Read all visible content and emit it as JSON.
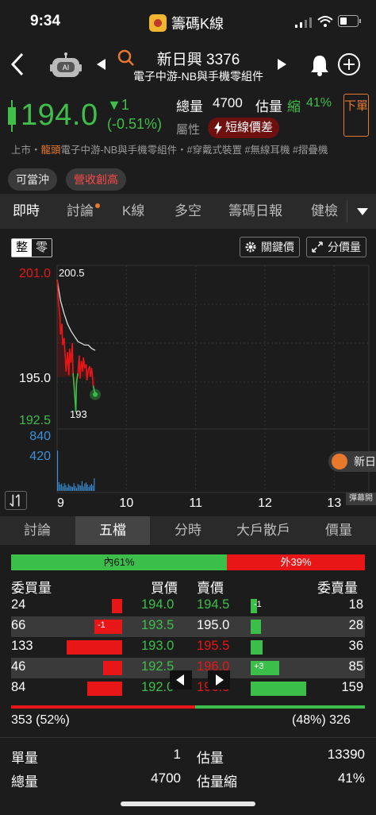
{
  "status_bar": {
    "time": "9:34",
    "app_title": "籌碼K線"
  },
  "header": {
    "stock_name": "新日興 3376",
    "sector": "電子中游-NB與手機零組件",
    "ai_label": "AI"
  },
  "quote": {
    "price": "194.0",
    "change": "▼1",
    "change_pct": "(-0.51%)",
    "total_volume_label": "總量",
    "total_volume": "4700",
    "est_volume_label": "估量",
    "est_status": "縮",
    "est_pct": "41%",
    "attribute_label": "屬性",
    "attribute_badge": "短線價差",
    "order_button": "下單",
    "color_down": "#3fbf4a",
    "color_up": "#e81616"
  },
  "tags": {
    "market": "上市",
    "sep1": "・",
    "leader": "龍頭",
    "sector": "電子中游-NB與手機零組件",
    "sep2": "・",
    "concepts": "#穿戴式裝置 #無線耳機 #摺疊機"
  },
  "pills": [
    "可當沖",
    "營收創高"
  ],
  "tabs": [
    "即時",
    "討論",
    "K線",
    "多空",
    "籌碼日報",
    "健檢"
  ],
  "chart": {
    "toggle_on": "整",
    "toggle_off": "零",
    "key_price_button": "關鍵價",
    "price_dist_button": "分價量",
    "side_chip": "新日",
    "popup_button": "彈幕開"
  },
  "chart_data": {
    "type": "line",
    "title": "",
    "y_labels": {
      "high": "201.0",
      "mid": "195.0",
      "low": "192.5"
    },
    "vol_labels": {
      "top": "840",
      "mid": "420"
    },
    "x_ticks": [
      "9",
      "10",
      "11",
      "12",
      "13"
    ],
    "annotations": {
      "max": "200.5",
      "min": "193"
    },
    "ylim": [
      192.5,
      201.0
    ],
    "xlim": [
      9,
      13.5
    ],
    "price_series": [
      [
        9.0,
        200.5
      ],
      [
        9.02,
        199.2
      ],
      [
        9.04,
        198.5
      ],
      [
        9.05,
        197.4
      ],
      [
        9.07,
        198.0
      ],
      [
        9.08,
        196.8
      ],
      [
        9.1,
        197.2
      ],
      [
        9.12,
        196.0
      ],
      [
        9.13,
        195.3
      ],
      [
        9.15,
        196.4
      ],
      [
        9.17,
        195.1
      ],
      [
        9.18,
        196.6
      ],
      [
        9.2,
        195.8
      ],
      [
        9.22,
        196.9
      ],
      [
        9.23,
        195.2
      ],
      [
        9.25,
        194.2
      ],
      [
        9.27,
        193.0
      ],
      [
        9.28,
        194.7
      ],
      [
        9.3,
        195.2
      ],
      [
        9.32,
        196.2
      ],
      [
        9.33,
        194.9
      ],
      [
        9.35,
        195.9
      ],
      [
        9.37,
        195.3
      ],
      [
        9.38,
        196.1
      ],
      [
        9.4,
        195.5
      ],
      [
        9.42,
        195.7
      ],
      [
        9.43,
        194.8
      ],
      [
        9.45,
        195.4
      ],
      [
        9.47,
        195.6
      ],
      [
        9.48,
        195.0
      ],
      [
        9.5,
        195.5
      ],
      [
        9.52,
        194.5
      ],
      [
        9.55,
        194.0
      ]
    ],
    "avg_series": [
      [
        9.0,
        200.5
      ],
      [
        9.05,
        199.3
      ],
      [
        9.1,
        198.6
      ],
      [
        9.15,
        198.0
      ],
      [
        9.2,
        197.6
      ],
      [
        9.25,
        197.3
      ],
      [
        9.3,
        197.0
      ],
      [
        9.35,
        196.9
      ],
      [
        9.4,
        196.8
      ],
      [
        9.45,
        196.8
      ],
      [
        9.5,
        196.6
      ],
      [
        9.55,
        196.5
      ]
    ],
    "volumes": [
      820,
      180,
      130,
      150,
      90,
      160,
      120,
      70,
      140,
      110,
      90,
      80,
      160,
      100,
      60,
      140,
      120,
      110,
      200,
      90,
      150,
      170,
      130,
      80,
      120,
      140,
      110,
      260
    ],
    "vol_ylim": [
      0,
      1260
    ],
    "colors": {
      "up": "#e81616",
      "down": "#3cbf4a",
      "avg": "#dddddd",
      "volume": "#3a8fd8"
    }
  },
  "subtabs": [
    "討論",
    "五檔",
    "分時",
    "大戶散戶",
    "價量"
  ],
  "orderbook": {
    "inner_label": "內61%",
    "inner_frac": 0.61,
    "outer_label": "外39%",
    "headers": {
      "bid_qty": "委買量",
      "bid_price": "買價",
      "ask_price": "賣價",
      "ask_qty": "委賣量"
    },
    "rows": [
      {
        "bid_qty": "24",
        "bid_price": "194.0",
        "bid_frac": 0.18,
        "bid_delta": "",
        "ask_price": "194.5",
        "ask_qty": "18",
        "ask_frac": 0.12,
        "ask_delta": "-1",
        "bid_price_color": "#3cbf4a",
        "ask_price_color": "#3cbf4a"
      },
      {
        "bid_qty": "66",
        "bid_price": "193.5",
        "bid_frac": 0.5,
        "bid_delta": "-1",
        "ask_price": "195.0",
        "ask_qty": "28",
        "ask_frac": 0.18,
        "ask_delta": "",
        "bid_price_color": "#3cbf4a",
        "ask_price_color": "#ffffff"
      },
      {
        "bid_qty": "133",
        "bid_price": "193.0",
        "bid_frac": 1.0,
        "bid_delta": "",
        "ask_price": "195.5",
        "ask_qty": "36",
        "ask_frac": 0.22,
        "ask_delta": "",
        "bid_price_color": "#3cbf4a",
        "ask_price_color": "#e81616"
      },
      {
        "bid_qty": "46",
        "bid_price": "192.5",
        "bid_frac": 0.35,
        "bid_delta": "",
        "ask_price": "196.0",
        "ask_qty": "85",
        "ask_frac": 0.52,
        "ask_delta": "+3",
        "bid_price_color": "#3cbf4a",
        "ask_price_color": "#e81616"
      },
      {
        "bid_qty": "84",
        "bid_price": "192.0",
        "bid_frac": 0.63,
        "bid_delta": "",
        "ask_price": "196.5",
        "ask_qty": "159",
        "ask_frac": 1.0,
        "ask_delta": "",
        "bid_price_color": "#3cbf4a",
        "ask_price_color": "#e81616"
      }
    ],
    "bid_total": "353 (52%)",
    "ask_total": "(48%) 326",
    "bid_total_frac": 0.52
  },
  "stats": {
    "single_label": "單量",
    "single_value": "1",
    "est_label": "估量",
    "est_value": "13390",
    "total_label": "總量",
    "total_value": "4700",
    "est_shrink_label": "估量縮",
    "est_shrink_value": "41%"
  }
}
